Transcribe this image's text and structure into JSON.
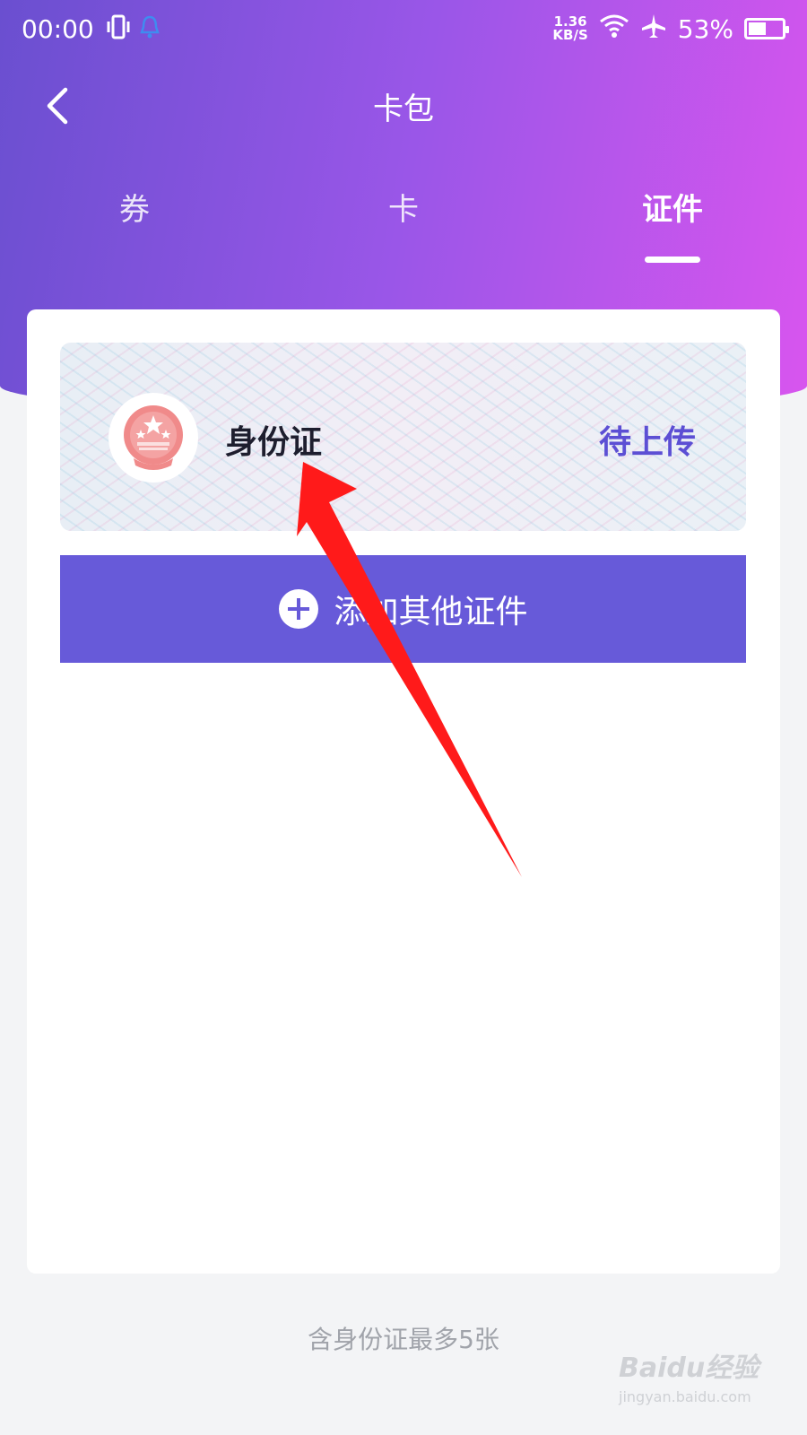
{
  "status_bar": {
    "time": "00:00",
    "speed_value": "1.36",
    "speed_unit": "KB/S",
    "battery": "53%",
    "battery_level": 0.53,
    "icons": [
      "vibrate-icon",
      "bell-icon",
      "wifi-icon",
      "airplane-icon",
      "battery-icon"
    ]
  },
  "nav": {
    "title": "卡包"
  },
  "tabs": [
    {
      "label": "券",
      "active": false
    },
    {
      "label": "卡",
      "active": false
    },
    {
      "label": "证件",
      "active": true
    }
  ],
  "id_card": {
    "title": "身份证",
    "status": "待上传"
  },
  "add_button": {
    "label": "添加其他证件"
  },
  "footer_note": "含身份证最多5张",
  "watermark": {
    "logo": "Baidu经验",
    "url": "jingyan.baidu.com"
  },
  "colors": {
    "accent": "#675ad9",
    "status_text": "#5c4fd4",
    "gradient_start": "#6a4fd0",
    "gradient_end": "#d855ee",
    "annotation_arrow": "#ff1a1a"
  }
}
